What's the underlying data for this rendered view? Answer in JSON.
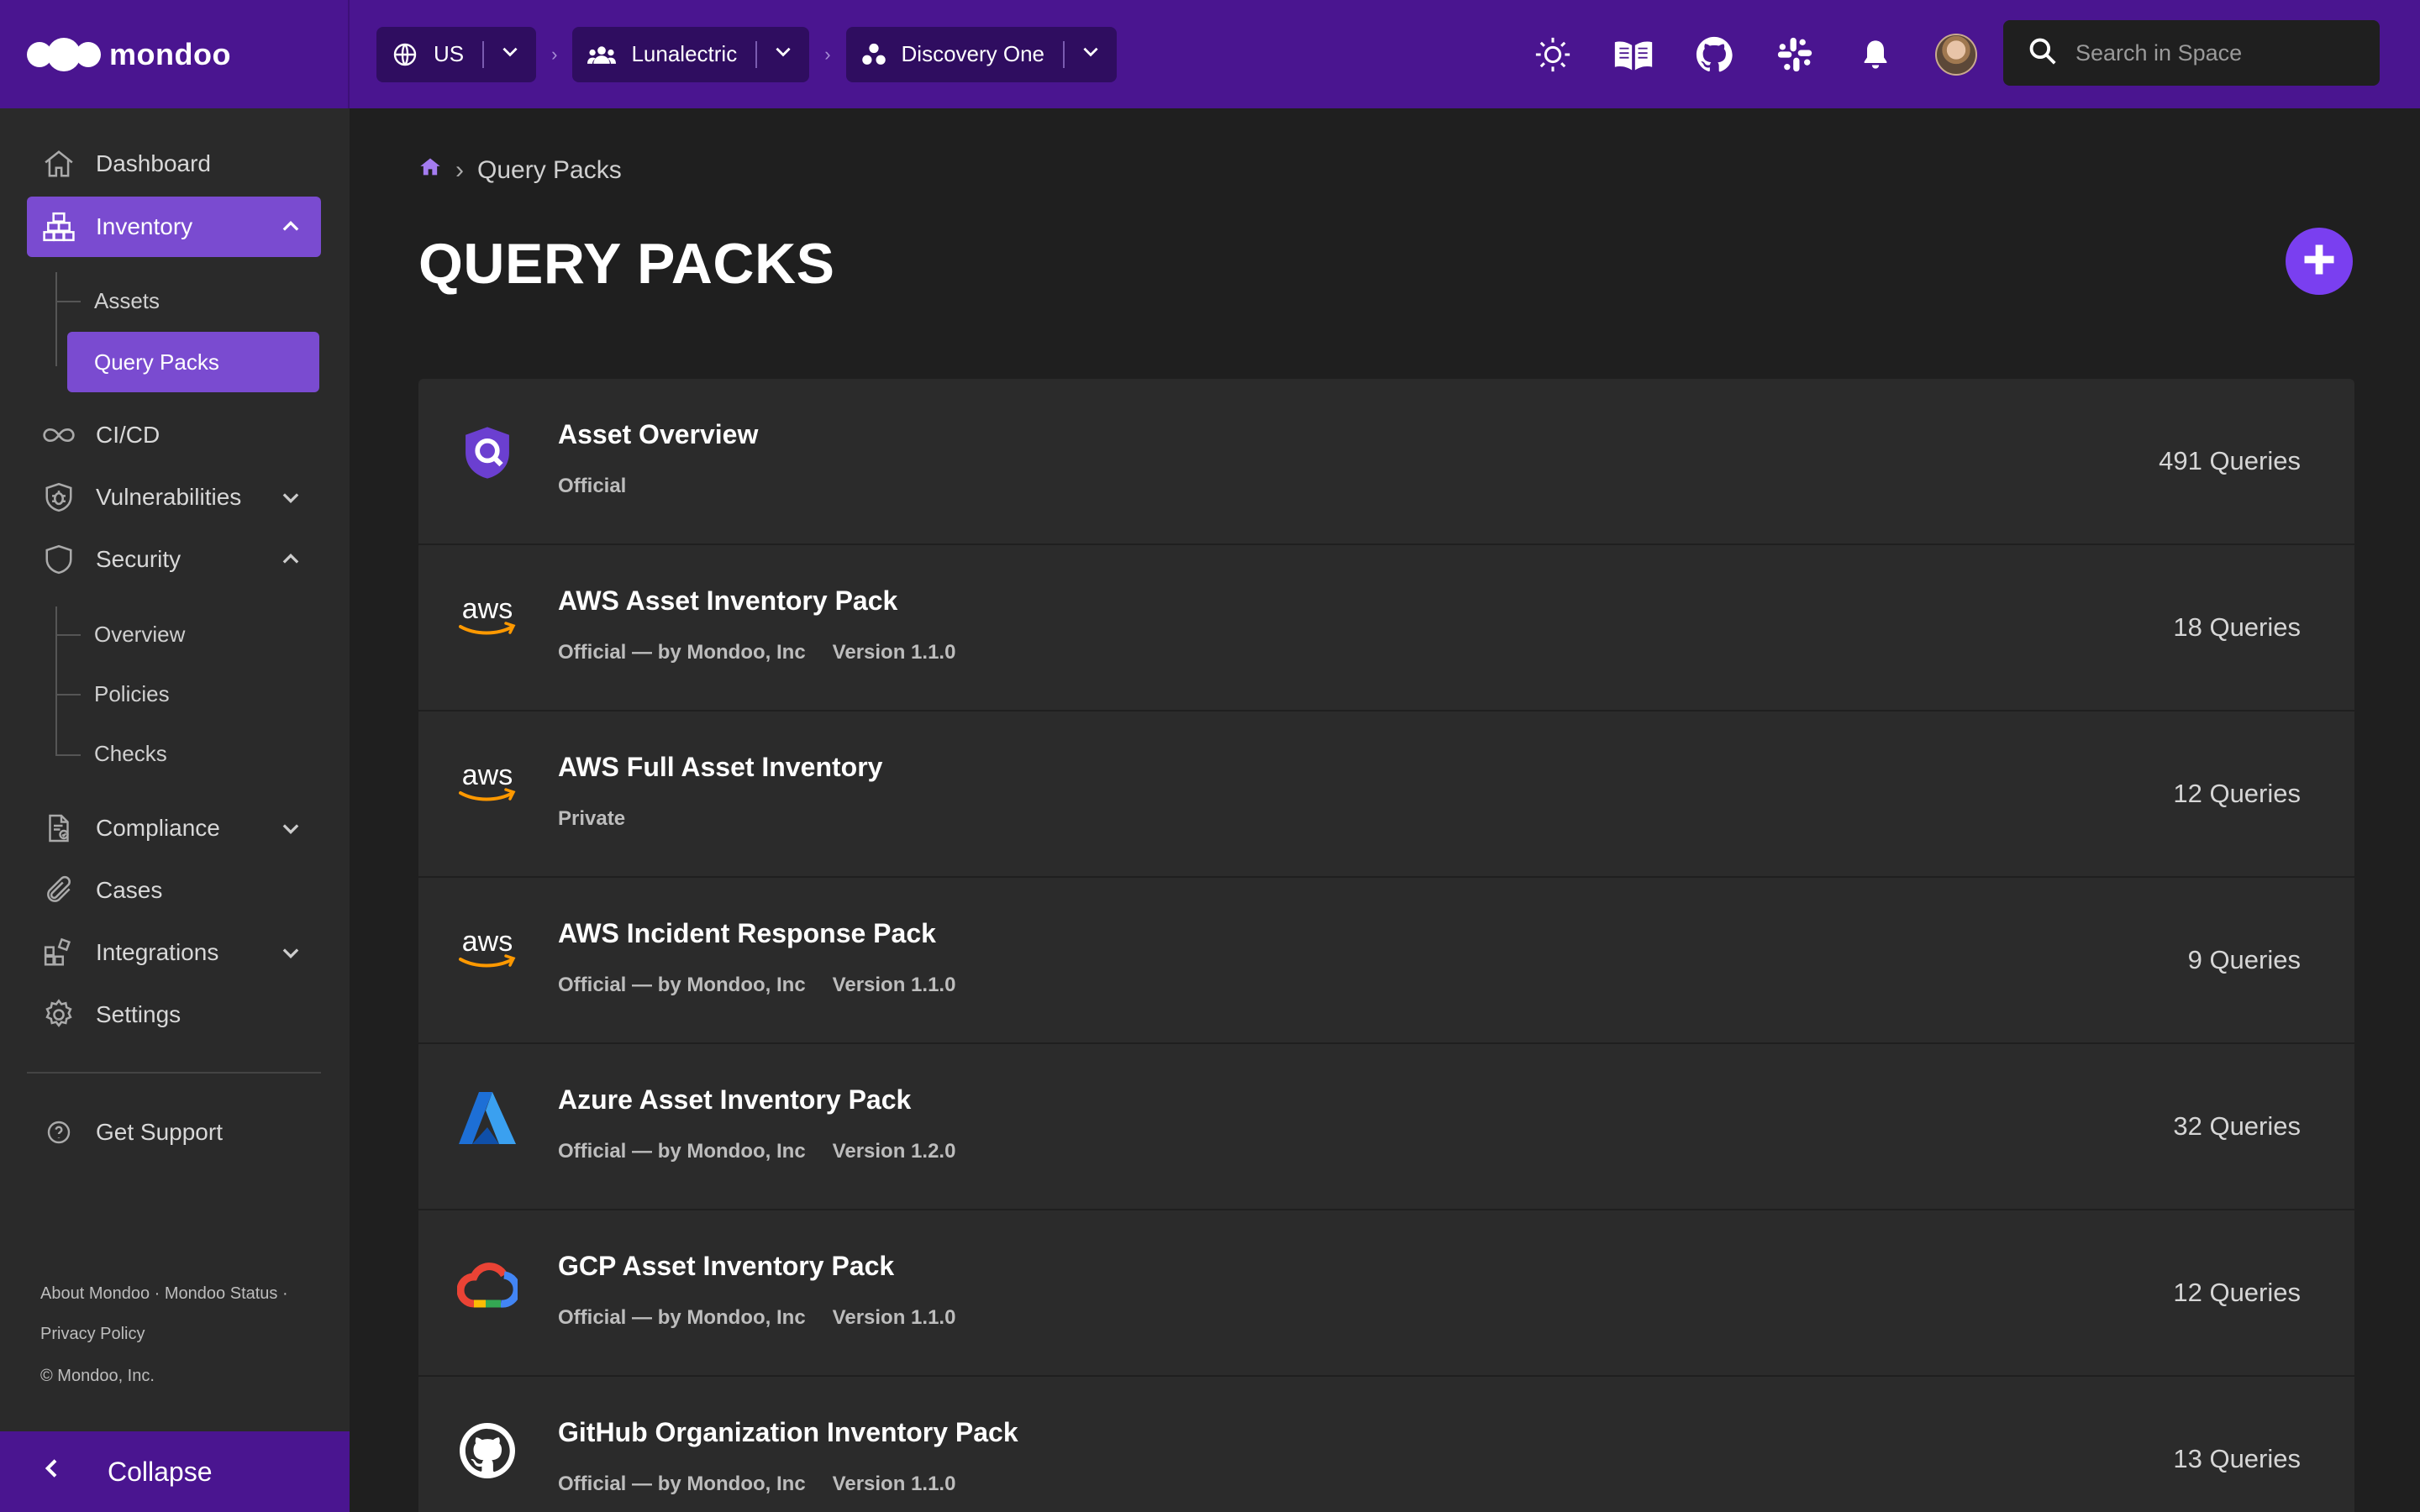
{
  "brand": {
    "name": "mondoo"
  },
  "topbar": {
    "region": "US",
    "organization": "Lunalectric",
    "space": "Discovery One",
    "icons": [
      "theme-toggle-icon",
      "docs-book-icon",
      "github-icon",
      "slack-icon",
      "bell-icon",
      "avatar"
    ],
    "search_placeholder": "Search in Space"
  },
  "sidebar": {
    "items": {
      "dashboard": "Dashboard",
      "inventory": "Inventory",
      "assets": "Assets",
      "query_packs": "Query Packs",
      "cicd": "CI/CD",
      "vulnerabilities": "Vulnerabilities",
      "security": "Security",
      "overview": "Overview",
      "policies": "Policies",
      "checks": "Checks",
      "compliance": "Compliance",
      "cases": "Cases",
      "integrations": "Integrations",
      "settings": "Settings",
      "support": "Get Support"
    },
    "footer": {
      "about": "About Mondoo",
      "status": "Mondoo Status",
      "privacy": "Privacy Policy",
      "copyright": "© Mondoo, Inc."
    },
    "collapse": "Collapse"
  },
  "main": {
    "breadcrumb": "Query Packs",
    "title": "QUERY PACKS",
    "packs": [
      {
        "icon": "mondoo-shield-icon",
        "title": "Asset Overview",
        "meta": "Official",
        "version": "",
        "count": "491 Queries"
      },
      {
        "icon": "aws-icon",
        "title": "AWS Asset Inventory Pack",
        "meta": "Official — by Mondoo, Inc",
        "version": "Version 1.1.0",
        "count": "18 Queries"
      },
      {
        "icon": "aws-icon",
        "title": "AWS Full Asset Inventory",
        "meta": "Private",
        "version": "",
        "count": "12 Queries"
      },
      {
        "icon": "aws-icon",
        "title": "AWS Incident Response Pack",
        "meta": "Official — by Mondoo, Inc",
        "version": "Version 1.1.0",
        "count": "9 Queries"
      },
      {
        "icon": "azure-icon",
        "title": "Azure Asset Inventory Pack",
        "meta": "Official — by Mondoo, Inc",
        "version": "Version 1.2.0",
        "count": "32 Queries"
      },
      {
        "icon": "gcp-icon",
        "title": "GCP Asset Inventory Pack",
        "meta": "Official — by Mondoo, Inc",
        "version": "Version 1.1.0",
        "count": "12 Queries"
      },
      {
        "icon": "github-icon",
        "title": "GitHub Organization Inventory Pack",
        "meta": "Official — by Mondoo, Inc",
        "version": "Version 1.1.0",
        "count": "13 Queries"
      }
    ]
  },
  "colors": {
    "brand": "#4a1590",
    "accent": "#7a4bd0",
    "add_button": "#7a3ff0"
  }
}
